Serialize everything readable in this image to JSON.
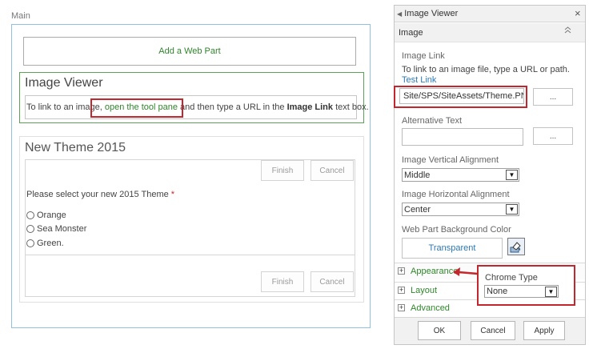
{
  "main_zone": {
    "title": "Main"
  },
  "add_web_part": {
    "label": "Add a Web Part"
  },
  "image_viewer_part": {
    "title": "Image Viewer",
    "message_before": "To link to an image, ",
    "message_link": "open the tool pane",
    "message_middle": " and then type a URL in the ",
    "message_bold": "Image Link",
    "message_after": " text box."
  },
  "theme_part": {
    "title": "New Theme 2015",
    "finish_label": "Finish",
    "cancel_label": "Cancel",
    "question": "Please select your new 2015 Theme",
    "required_mark": " *",
    "options": [
      "Orange",
      "Sea Monster",
      "Green."
    ]
  },
  "tool_pane": {
    "title": "Image Viewer",
    "close_glyph": "×",
    "section_title": "Image",
    "collapse_glyph": "⌃",
    "image_link": {
      "label": "Image Link",
      "help": "To link to an image file, type a URL or path.",
      "test_link": "Test Link",
      "value": "Site/SPS/SiteAssets/Theme.PNG",
      "browse_label": "..."
    },
    "alt_text": {
      "label": "Alternative Text",
      "value": "",
      "browse_label": "..."
    },
    "vertical_alignment": {
      "label": "Image Vertical Alignment",
      "value": "Middle"
    },
    "horizontal_alignment": {
      "label": "Image Horizontal Alignment",
      "value": "Center"
    },
    "background": {
      "label": "Web Part Background Color",
      "value": "Transparent"
    },
    "sections": [
      {
        "label": "Appearance",
        "icon": "+"
      },
      {
        "label": "Layout",
        "icon": "+"
      },
      {
        "label": "Advanced",
        "icon": "+"
      }
    ],
    "chrome_type": {
      "label": "Chrome Type",
      "value": "None"
    },
    "buttons": {
      "ok": "OK",
      "cancel": "Cancel",
      "apply": "Apply"
    }
  },
  "colors": {
    "accent_green": "#30862c",
    "highlight_red": "#c4262e",
    "link_blue": "#2a7ab8",
    "zone_border": "#92c0e0"
  }
}
